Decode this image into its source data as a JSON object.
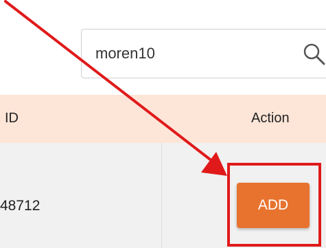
{
  "search": {
    "value": "moren10",
    "icon": "search-icon"
  },
  "table": {
    "headers": {
      "id": "ID",
      "action": "Action"
    },
    "rows": [
      {
        "id": "48712",
        "action_label": "ADD"
      }
    ]
  },
  "annotation": {
    "color": "#e01a1a",
    "arrow_icon": "arrow-icon"
  },
  "colors": {
    "header_bg": "#fde5d8",
    "button_bg": "#e8732f",
    "row_bg": "#f1f1f1"
  }
}
